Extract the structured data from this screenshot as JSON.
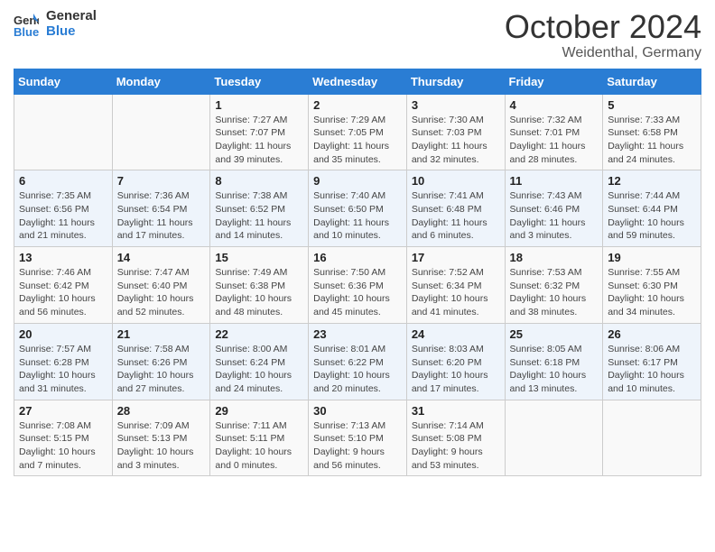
{
  "header": {
    "logo_line1": "General",
    "logo_line2": "Blue",
    "month": "October 2024",
    "location": "Weidenthal, Germany"
  },
  "weekdays": [
    "Sunday",
    "Monday",
    "Tuesday",
    "Wednesday",
    "Thursday",
    "Friday",
    "Saturday"
  ],
  "weeks": [
    [
      {
        "day": "",
        "sunrise": "",
        "sunset": "",
        "daylight": ""
      },
      {
        "day": "",
        "sunrise": "",
        "sunset": "",
        "daylight": ""
      },
      {
        "day": "1",
        "sunrise": "Sunrise: 7:27 AM",
        "sunset": "Sunset: 7:07 PM",
        "daylight": "Daylight: 11 hours and 39 minutes."
      },
      {
        "day": "2",
        "sunrise": "Sunrise: 7:29 AM",
        "sunset": "Sunset: 7:05 PM",
        "daylight": "Daylight: 11 hours and 35 minutes."
      },
      {
        "day": "3",
        "sunrise": "Sunrise: 7:30 AM",
        "sunset": "Sunset: 7:03 PM",
        "daylight": "Daylight: 11 hours and 32 minutes."
      },
      {
        "day": "4",
        "sunrise": "Sunrise: 7:32 AM",
        "sunset": "Sunset: 7:01 PM",
        "daylight": "Daylight: 11 hours and 28 minutes."
      },
      {
        "day": "5",
        "sunrise": "Sunrise: 7:33 AM",
        "sunset": "Sunset: 6:58 PM",
        "daylight": "Daylight: 11 hours and 24 minutes."
      }
    ],
    [
      {
        "day": "6",
        "sunrise": "Sunrise: 7:35 AM",
        "sunset": "Sunset: 6:56 PM",
        "daylight": "Daylight: 11 hours and 21 minutes."
      },
      {
        "day": "7",
        "sunrise": "Sunrise: 7:36 AM",
        "sunset": "Sunset: 6:54 PM",
        "daylight": "Daylight: 11 hours and 17 minutes."
      },
      {
        "day": "8",
        "sunrise": "Sunrise: 7:38 AM",
        "sunset": "Sunset: 6:52 PM",
        "daylight": "Daylight: 11 hours and 14 minutes."
      },
      {
        "day": "9",
        "sunrise": "Sunrise: 7:40 AM",
        "sunset": "Sunset: 6:50 PM",
        "daylight": "Daylight: 11 hours and 10 minutes."
      },
      {
        "day": "10",
        "sunrise": "Sunrise: 7:41 AM",
        "sunset": "Sunset: 6:48 PM",
        "daylight": "Daylight: 11 hours and 6 minutes."
      },
      {
        "day": "11",
        "sunrise": "Sunrise: 7:43 AM",
        "sunset": "Sunset: 6:46 PM",
        "daylight": "Daylight: 11 hours and 3 minutes."
      },
      {
        "day": "12",
        "sunrise": "Sunrise: 7:44 AM",
        "sunset": "Sunset: 6:44 PM",
        "daylight": "Daylight: 10 hours and 59 minutes."
      }
    ],
    [
      {
        "day": "13",
        "sunrise": "Sunrise: 7:46 AM",
        "sunset": "Sunset: 6:42 PM",
        "daylight": "Daylight: 10 hours and 56 minutes."
      },
      {
        "day": "14",
        "sunrise": "Sunrise: 7:47 AM",
        "sunset": "Sunset: 6:40 PM",
        "daylight": "Daylight: 10 hours and 52 minutes."
      },
      {
        "day": "15",
        "sunrise": "Sunrise: 7:49 AM",
        "sunset": "Sunset: 6:38 PM",
        "daylight": "Daylight: 10 hours and 48 minutes."
      },
      {
        "day": "16",
        "sunrise": "Sunrise: 7:50 AM",
        "sunset": "Sunset: 6:36 PM",
        "daylight": "Daylight: 10 hours and 45 minutes."
      },
      {
        "day": "17",
        "sunrise": "Sunrise: 7:52 AM",
        "sunset": "Sunset: 6:34 PM",
        "daylight": "Daylight: 10 hours and 41 minutes."
      },
      {
        "day": "18",
        "sunrise": "Sunrise: 7:53 AM",
        "sunset": "Sunset: 6:32 PM",
        "daylight": "Daylight: 10 hours and 38 minutes."
      },
      {
        "day": "19",
        "sunrise": "Sunrise: 7:55 AM",
        "sunset": "Sunset: 6:30 PM",
        "daylight": "Daylight: 10 hours and 34 minutes."
      }
    ],
    [
      {
        "day": "20",
        "sunrise": "Sunrise: 7:57 AM",
        "sunset": "Sunset: 6:28 PM",
        "daylight": "Daylight: 10 hours and 31 minutes."
      },
      {
        "day": "21",
        "sunrise": "Sunrise: 7:58 AM",
        "sunset": "Sunset: 6:26 PM",
        "daylight": "Daylight: 10 hours and 27 minutes."
      },
      {
        "day": "22",
        "sunrise": "Sunrise: 8:00 AM",
        "sunset": "Sunset: 6:24 PM",
        "daylight": "Daylight: 10 hours and 24 minutes."
      },
      {
        "day": "23",
        "sunrise": "Sunrise: 8:01 AM",
        "sunset": "Sunset: 6:22 PM",
        "daylight": "Daylight: 10 hours and 20 minutes."
      },
      {
        "day": "24",
        "sunrise": "Sunrise: 8:03 AM",
        "sunset": "Sunset: 6:20 PM",
        "daylight": "Daylight: 10 hours and 17 minutes."
      },
      {
        "day": "25",
        "sunrise": "Sunrise: 8:05 AM",
        "sunset": "Sunset: 6:18 PM",
        "daylight": "Daylight: 10 hours and 13 minutes."
      },
      {
        "day": "26",
        "sunrise": "Sunrise: 8:06 AM",
        "sunset": "Sunset: 6:17 PM",
        "daylight": "Daylight: 10 hours and 10 minutes."
      }
    ],
    [
      {
        "day": "27",
        "sunrise": "Sunrise: 7:08 AM",
        "sunset": "Sunset: 5:15 PM",
        "daylight": "Daylight: 10 hours and 7 minutes."
      },
      {
        "day": "28",
        "sunrise": "Sunrise: 7:09 AM",
        "sunset": "Sunset: 5:13 PM",
        "daylight": "Daylight: 10 hours and 3 minutes."
      },
      {
        "day": "29",
        "sunrise": "Sunrise: 7:11 AM",
        "sunset": "Sunset: 5:11 PM",
        "daylight": "Daylight: 10 hours and 0 minutes."
      },
      {
        "day": "30",
        "sunrise": "Sunrise: 7:13 AM",
        "sunset": "Sunset: 5:10 PM",
        "daylight": "Daylight: 9 hours and 56 minutes."
      },
      {
        "day": "31",
        "sunrise": "Sunrise: 7:14 AM",
        "sunset": "Sunset: 5:08 PM",
        "daylight": "Daylight: 9 hours and 53 minutes."
      },
      {
        "day": "",
        "sunrise": "",
        "sunset": "",
        "daylight": ""
      },
      {
        "day": "",
        "sunrise": "",
        "sunset": "",
        "daylight": ""
      }
    ]
  ]
}
